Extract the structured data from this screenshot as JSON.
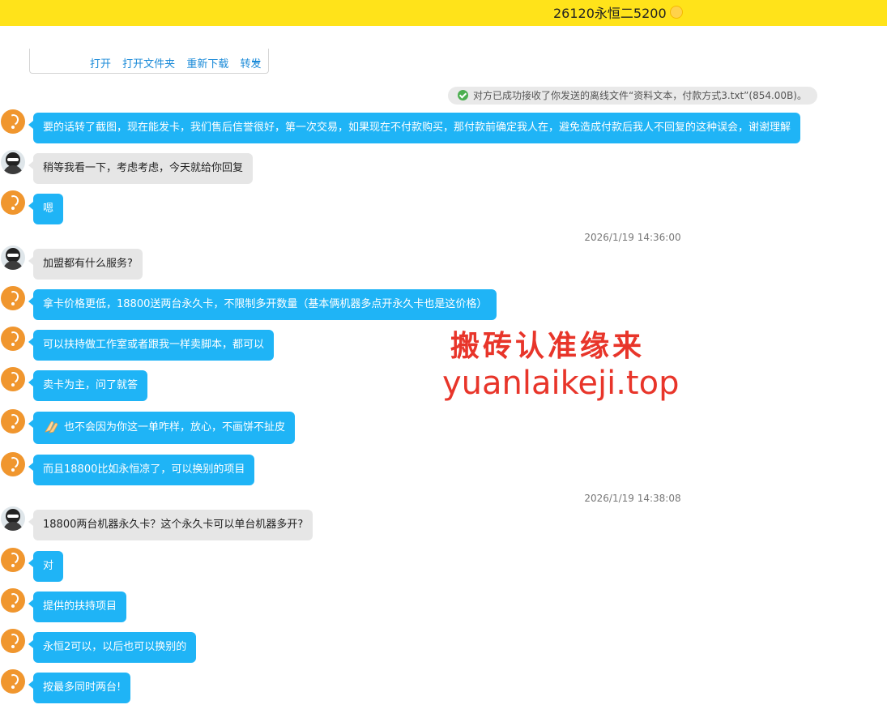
{
  "header": {
    "title": "26120永恒二5200"
  },
  "file_card": {
    "actions": [
      "打开",
      "打开文件夹",
      "重新下载",
      "转发"
    ]
  },
  "system_notice": "对方已成功接收了你发送的离线文件“资料文本，付款方式3.txt”(854.00B)。",
  "timestamps": [
    "2026/1/19 14:36:00",
    "2026/1/19 14:38:08"
  ],
  "messages": [
    {
      "from": "me",
      "text": "要的话转了截图，现在能发卡，我们售后信誉很好，第一次交易，如果现在不付款购买，那付款前确定我人在，避免造成付款后我人不回复的这种误会，谢谢理解"
    },
    {
      "from": "other",
      "text": "稍等我看一下，考虑考虑，今天就给你回复"
    },
    {
      "from": "me",
      "text": "嗯"
    },
    {
      "from": "other",
      "text": "加盟都有什么服务?"
    },
    {
      "from": "me",
      "text": "拿卡价格更低，18800送两台永久卡，不限制多开数量（基本俩机器多点开永久卡也是这价格）"
    },
    {
      "from": "me",
      "text": "可以扶持做工作室或者跟我一样卖脚本，都可以"
    },
    {
      "from": "me",
      "text": "卖卡为主，问了就答"
    },
    {
      "from": "me",
      "text": "也不会因为你这一单咋样，放心，不画饼不扯皮"
    },
    {
      "from": "me",
      "text": "而且18800比如永恒凉了，可以换别的项目"
    },
    {
      "from": "other",
      "text": "18800两台机器永久卡？这个永久卡可以单台机器多开?"
    },
    {
      "from": "me",
      "text": "对"
    },
    {
      "from": "me",
      "text": "提供的扶持项目"
    },
    {
      "from": "me",
      "text": "永恒2可以，以后也可以换别的"
    },
    {
      "from": "me",
      "text": "按最多同时两台!"
    }
  ],
  "watermark": {
    "line1": "搬砖认准缘来",
    "line2": "yuanlaikeji.top"
  },
  "colors": {
    "header_bg": "#ffe31a",
    "my_bubble": "#1fb4f6",
    "other_bubble": "#e6e6e6",
    "watermark": "#e8352a"
  }
}
